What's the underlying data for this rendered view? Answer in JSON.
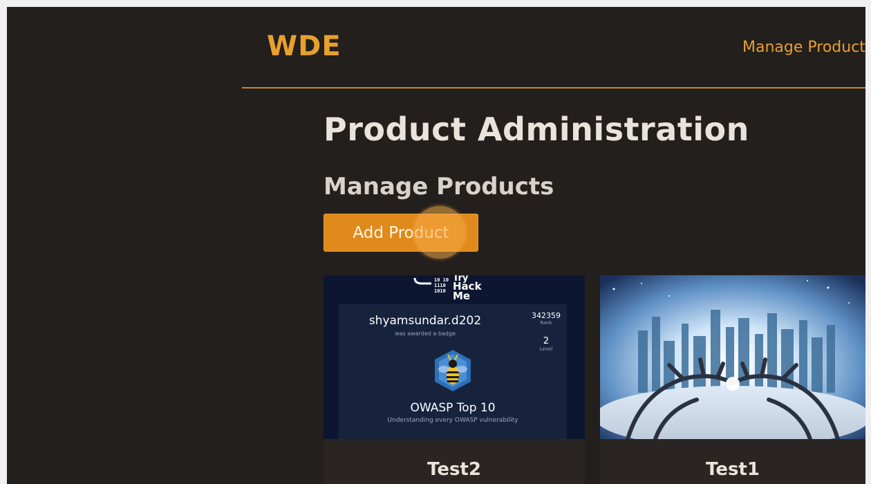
{
  "header": {
    "logo": "WDE",
    "nav_link": "Manage Products"
  },
  "main": {
    "page_title": "Product Administration",
    "section_title": "Manage Products",
    "add_button": "Add Product"
  },
  "products": [
    {
      "title": "Test2",
      "image": {
        "logo_text": "Try Hack Me",
        "username": "shyamsundar.d202",
        "awarded_text": "was awarded a badge",
        "rank_value": "342359",
        "rank_label": "Rank",
        "level_value": "2",
        "level_label": "Level",
        "course": "OWASP Top 10",
        "course_sub": "Understanding every OWASP vulnerability"
      }
    },
    {
      "title": "Test1"
    }
  ],
  "colors": {
    "accent": "#e8a02e",
    "button": "#e08a1c",
    "background": "#231f1d"
  }
}
